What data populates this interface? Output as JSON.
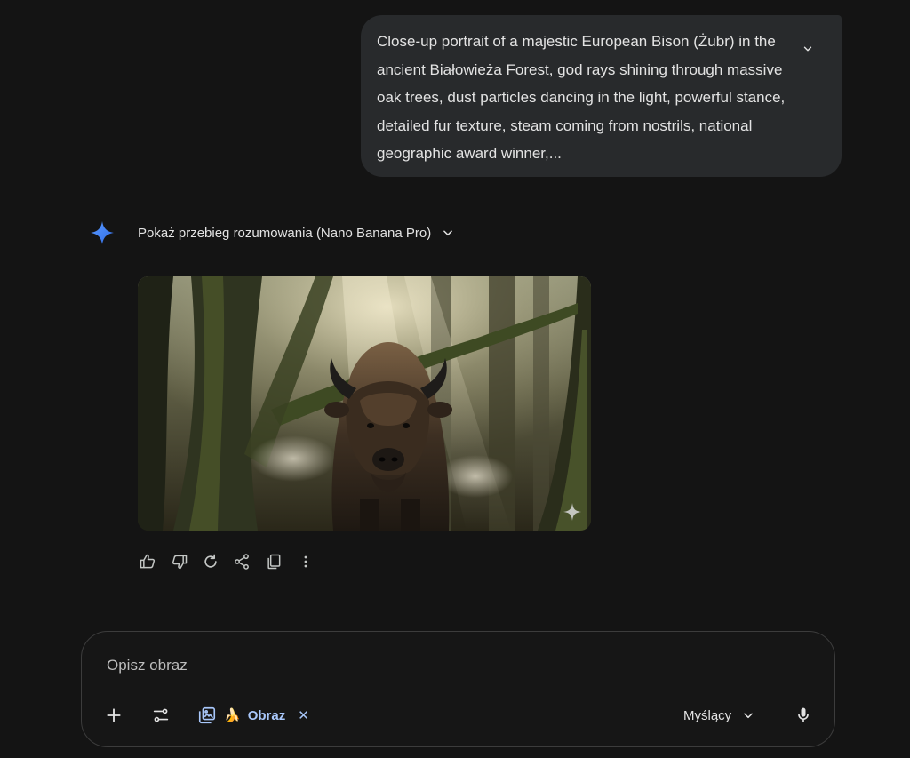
{
  "prompt": {
    "text": "Close-up portrait of a majestic European Bison (Żubr) in the ancient Białowieża Forest, god rays shining through massive oak trees, dust particles dancing in the light, powerful stance, detailed fur texture, steam coming from nostrils, national geographic award winner,..."
  },
  "response": {
    "reasoning_label": "Pokaż przebieg rozumowania (Nano Banana Pro)",
    "accent_color": "#4285f4"
  },
  "actions": {
    "icons": [
      "thumb-up-icon",
      "thumb-down-icon",
      "regenerate-icon",
      "share-icon",
      "copy-icon",
      "more-vert-icon"
    ]
  },
  "composer": {
    "placeholder": "Opisz obraz",
    "tool_chip": {
      "emoji": "🍌",
      "label": "Obraz",
      "close": "✕",
      "color": "#a8c7fa"
    },
    "mode_label": "Myślący"
  }
}
